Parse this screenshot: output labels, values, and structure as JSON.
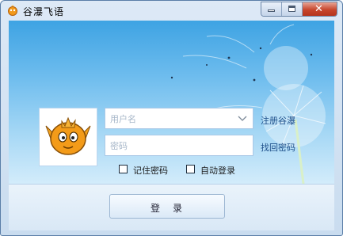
{
  "window": {
    "title": "谷瀑飞语"
  },
  "controls": {
    "minimize": "minimize",
    "maximize": "maximize",
    "close": "✕"
  },
  "login": {
    "username_placeholder": "用户名",
    "password_placeholder": "密码",
    "register_link": "注册谷瀑",
    "recover_link": "找回密码",
    "remember_label": "记住密码",
    "autologin_label": "自动登录",
    "login_button": "登　录"
  },
  "icons": {
    "app": "fish-icon",
    "avatar": "fish-avatar-icon",
    "dropdown": "chevron-down-icon"
  },
  "colors": {
    "accent": "#3ea3e3",
    "link": "#1d4e89",
    "close": "#c7462d"
  }
}
